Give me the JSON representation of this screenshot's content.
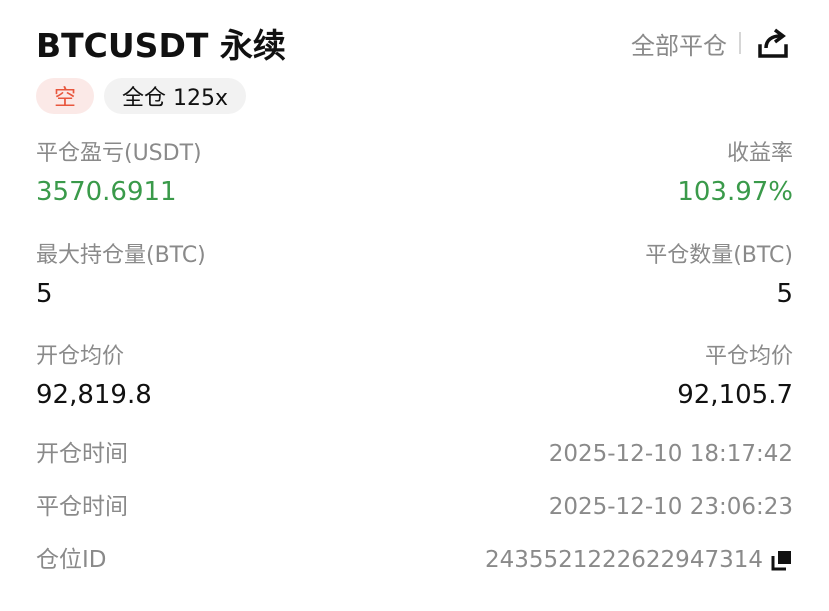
{
  "header": {
    "title": "BTCUSDT 永续",
    "close_all_label": "全部平仓",
    "share_icon": "share-icon"
  },
  "tags": {
    "direction": "空",
    "margin_leverage": "全仓 125x"
  },
  "stats": {
    "realized_pnl_label": "平仓盈亏(USDT)",
    "realized_pnl_value": "3570.6911",
    "roi_label": "收益率",
    "roi_value": "103.97%",
    "max_position_label": "最大持仓量(BTC)",
    "max_position_value": "5",
    "closed_qty_label": "平仓数量(BTC)",
    "closed_qty_value": "5",
    "entry_price_label": "开仓均价",
    "entry_price_value": "92,819.8",
    "exit_price_label": "平仓均价",
    "exit_price_value": "92,105.7"
  },
  "details": {
    "open_time_label": "开仓时间",
    "open_time_value": "2025-12-10 18:17:42",
    "close_time_label": "平仓时间",
    "close_time_value": "2025-12-10 23:06:23",
    "position_id_label": "仓位ID",
    "position_id_value": "2435521222622947314",
    "copy_icon": "copy-icon"
  },
  "colors": {
    "profit_green": "#3a9a4a",
    "short_red": "#e8563d",
    "muted_gray": "#8a8a8a"
  }
}
